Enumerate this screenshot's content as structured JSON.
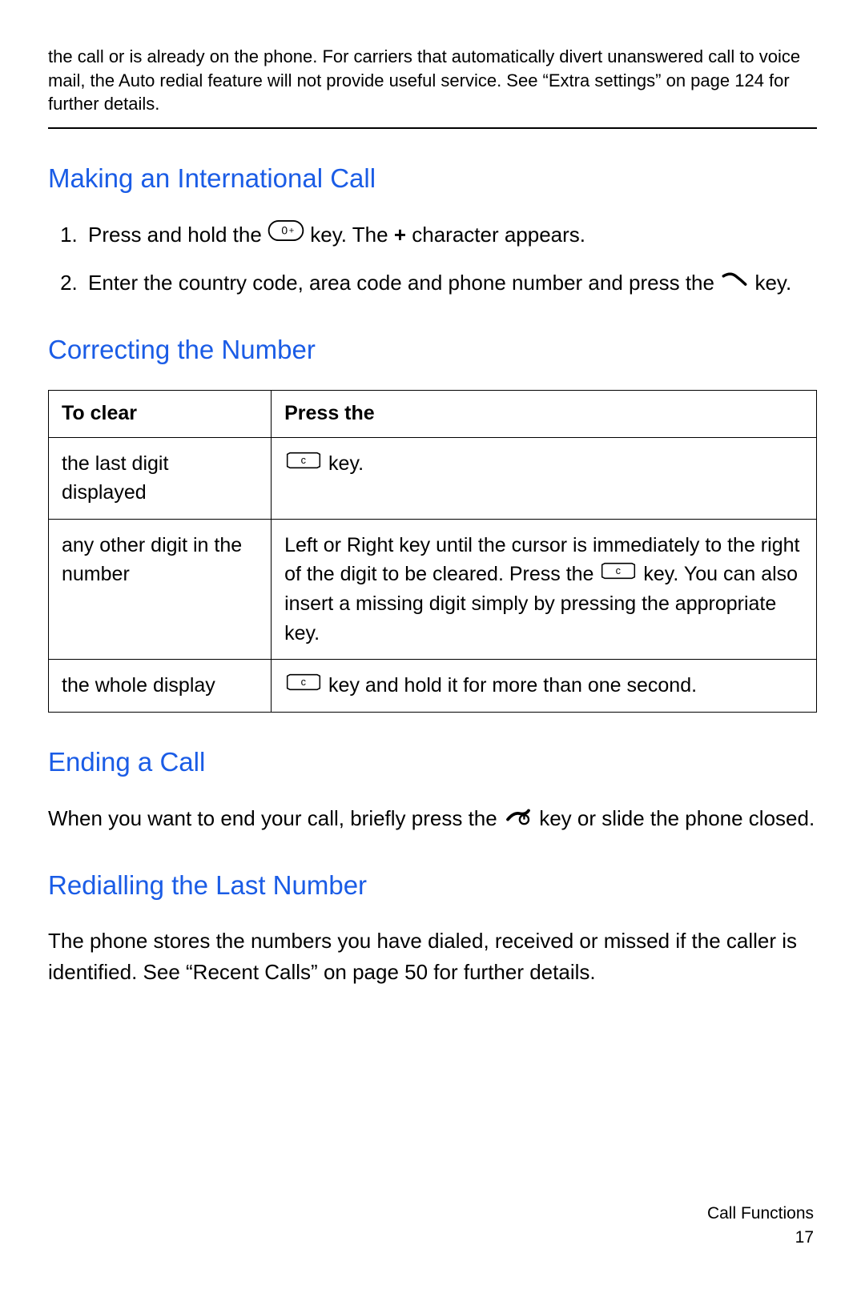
{
  "top_note": "the call or is already on the phone. For carriers that automatically divert unanswered call to voice mail, the Auto redial feature will not provide useful service. See “Extra settings” on page 124 for further details.",
  "sections": {
    "intl": {
      "title": "Making an International Call",
      "step1_a": "Press and hold the ",
      "step1_b": " key. The ",
      "step1_bold": "+",
      "step1_c": " character appears.",
      "step2_a": "Enter the country code, area code and phone number and press the ",
      "step2_b": " key."
    },
    "correcting": {
      "title": "Correcting the Number",
      "th1": "To clear",
      "th2": "Press the",
      "rows": [
        {
          "c1": "the last digit displayed",
          "c2_after_icon": " key."
        },
        {
          "c1": "any other digit in the number",
          "c2_before_icon": "Left or Right key until the cursor is immediately to the right of the digit to be cleared. Press the ",
          "c2_after_icon": " key. You can also insert a missing digit simply by pressing the appropriate key."
        },
        {
          "c1": "the whole display",
          "c2_after_icon": " key and hold it for more than one second."
        }
      ]
    },
    "ending": {
      "title": "Ending a Call",
      "text_a": "When you want to end your call, briefly press the ",
      "text_b": " key or slide the phone closed."
    },
    "redial": {
      "title": "Redialling the Last Number",
      "text": "The phone stores the numbers you have dialed, received or missed if the caller is identified. See “Recent Calls” on page 50 for further details."
    }
  },
  "footer": {
    "section": "Call Functions",
    "page": "17"
  }
}
